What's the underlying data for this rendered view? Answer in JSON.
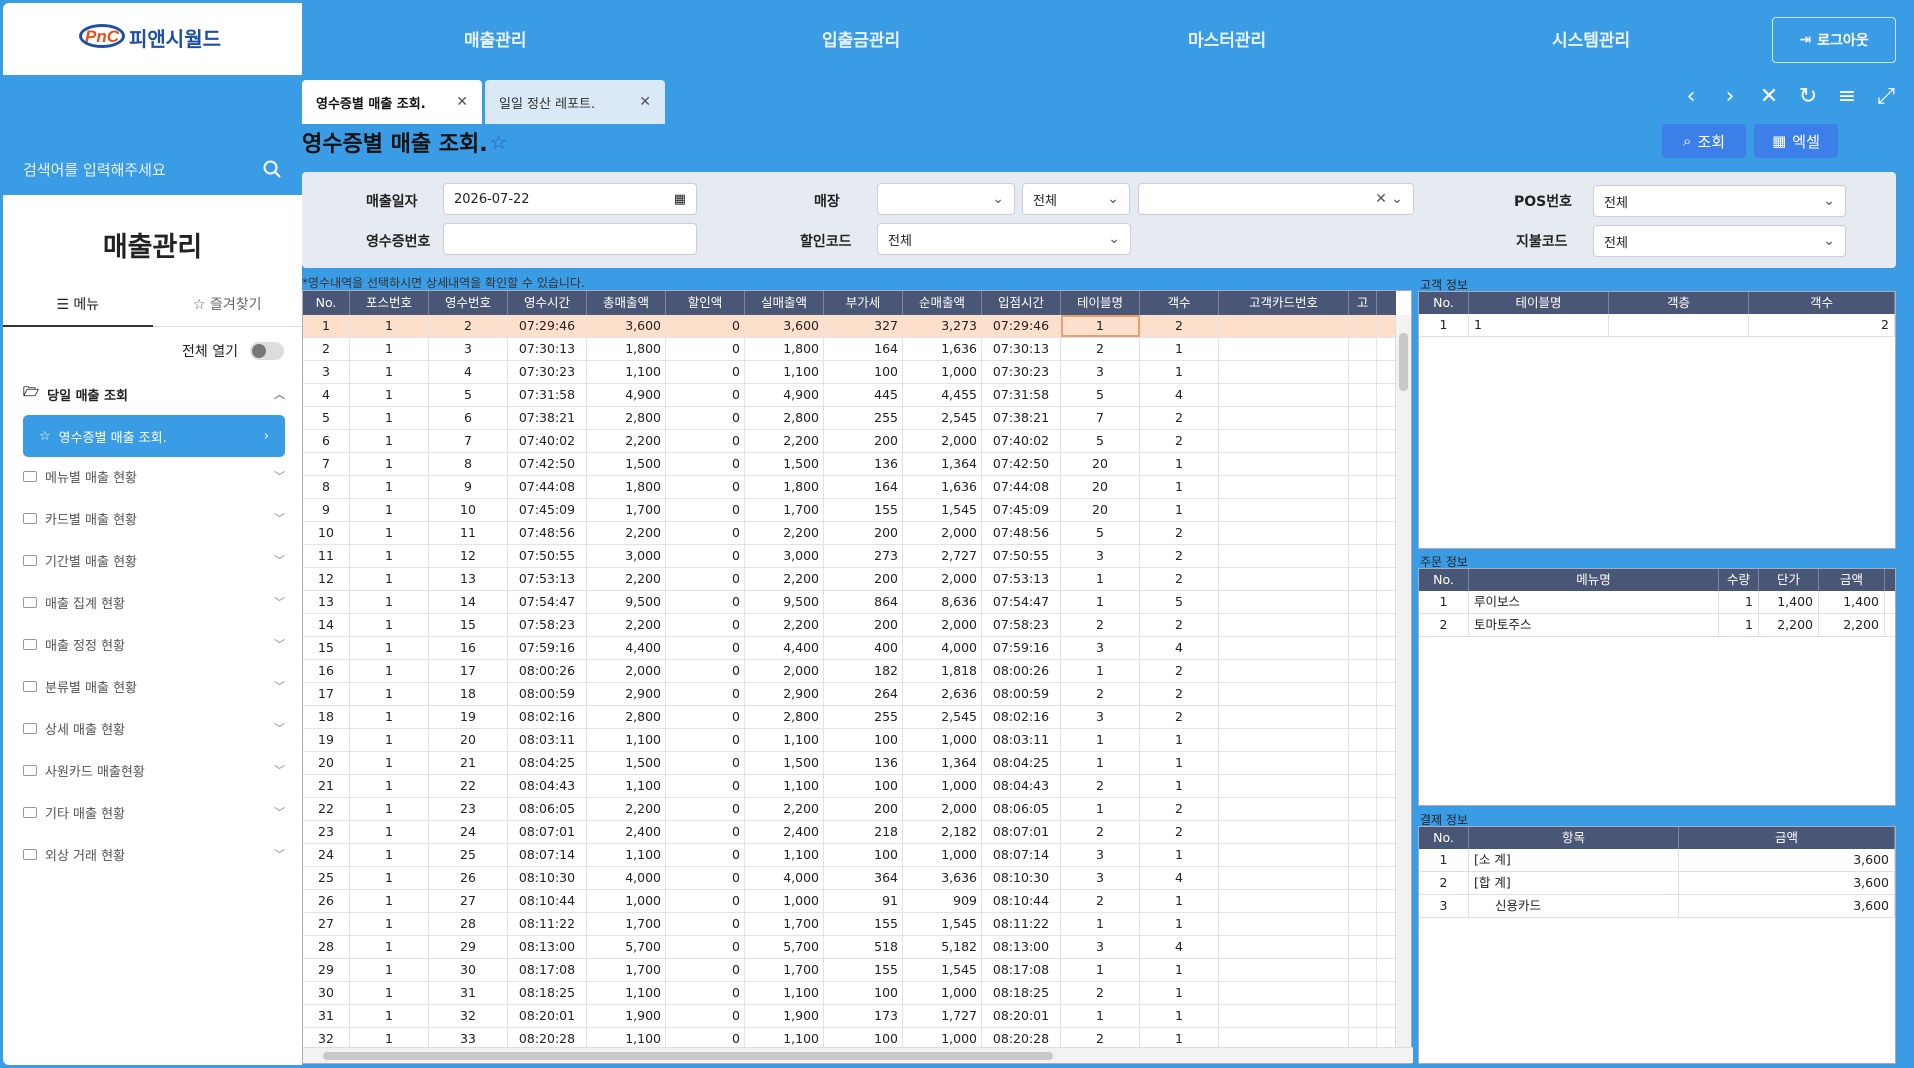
{
  "logo": {
    "brand": "PnC",
    "company": "피앤시월드"
  },
  "sidebar": {
    "search_placeholder": "검색어를 입력해주세요",
    "title": "매출관리",
    "tab_menu": "메뉴",
    "tab_fav": "즐겨찾기",
    "expand_all": "전체 열기",
    "group_head": "당일 매출 조회",
    "active_item": "영수증별 매출 조회.",
    "items": [
      "메뉴별 매출 현황",
      "카드별 매출 현황",
      "기간별 매출 현황",
      "매출 집계 현황",
      "매출 정정 현황",
      "분류별 매출 현황",
      "상세 매출 현황",
      "사원카드 매출현황",
      "기타 매출 현황",
      "외상 거래 현황"
    ]
  },
  "topnav": {
    "items": [
      "매출관리",
      "입출금관리",
      "마스터관리",
      "시스템관리"
    ],
    "logout": "로그아웃"
  },
  "tabs": [
    {
      "label": "영수증별 매출 조회."
    },
    {
      "label": "일일 정산 레포트."
    }
  ],
  "page": {
    "title": "영수증별 매출 조회.",
    "btn_search": "조회",
    "btn_excel": "엑셀"
  },
  "filters": {
    "date_label": "매출일자",
    "date_value": "2026-07-22",
    "store_label": "매장",
    "store_sel2": "전체",
    "pos_label": "POS번호",
    "pos_value": "전체",
    "receipt_label": "영수증번호",
    "discount_label": "할인코드",
    "discount_value": "전체",
    "pay_label": "지불코드",
    "pay_value": "전체"
  },
  "hint": "*영수내역을 선택하시면 상세내역을 확인할 수 있습니다.",
  "grid": {
    "headers": [
      "No.",
      "포스번호",
      "영수번호",
      "영수시간",
      "총매출액",
      "할인액",
      "실매출액",
      "부가세",
      "순매출액",
      "입점시간",
      "테이블명",
      "객수",
      "고객카드번호",
      "고"
    ],
    "rows": [
      [
        "1",
        "1",
        "2",
        "07:29:46",
        "3,600",
        "0",
        "3,600",
        "327",
        "3,273",
        "07:29:46",
        "1",
        "2"
      ],
      [
        "2",
        "1",
        "3",
        "07:30:13",
        "1,800",
        "0",
        "1,800",
        "164",
        "1,636",
        "07:30:13",
        "2",
        "1"
      ],
      [
        "3",
        "1",
        "4",
        "07:30:23",
        "1,100",
        "0",
        "1,100",
        "100",
        "1,000",
        "07:30:23",
        "3",
        "1"
      ],
      [
        "4",
        "1",
        "5",
        "07:31:58",
        "4,900",
        "0",
        "4,900",
        "445",
        "4,455",
        "07:31:58",
        "5",
        "4"
      ],
      [
        "5",
        "1",
        "6",
        "07:38:21",
        "2,800",
        "0",
        "2,800",
        "255",
        "2,545",
        "07:38:21",
        "7",
        "2"
      ],
      [
        "6",
        "1",
        "7",
        "07:40:02",
        "2,200",
        "0",
        "2,200",
        "200",
        "2,000",
        "07:40:02",
        "5",
        "2"
      ],
      [
        "7",
        "1",
        "8",
        "07:42:50",
        "1,500",
        "0",
        "1,500",
        "136",
        "1,364",
        "07:42:50",
        "20",
        "1"
      ],
      [
        "8",
        "1",
        "9",
        "07:44:08",
        "1,800",
        "0",
        "1,800",
        "164",
        "1,636",
        "07:44:08",
        "20",
        "1"
      ],
      [
        "9",
        "1",
        "10",
        "07:45:09",
        "1,700",
        "0",
        "1,700",
        "155",
        "1,545",
        "07:45:09",
        "20",
        "1"
      ],
      [
        "10",
        "1",
        "11",
        "07:48:56",
        "2,200",
        "0",
        "2,200",
        "200",
        "2,000",
        "07:48:56",
        "5",
        "2"
      ],
      [
        "11",
        "1",
        "12",
        "07:50:55",
        "3,000",
        "0",
        "3,000",
        "273",
        "2,727",
        "07:50:55",
        "3",
        "2"
      ],
      [
        "12",
        "1",
        "13",
        "07:53:13",
        "2,200",
        "0",
        "2,200",
        "200",
        "2,000",
        "07:53:13",
        "1",
        "2"
      ],
      [
        "13",
        "1",
        "14",
        "07:54:47",
        "9,500",
        "0",
        "9,500",
        "864",
        "8,636",
        "07:54:47",
        "1",
        "5"
      ],
      [
        "14",
        "1",
        "15",
        "07:58:23",
        "2,200",
        "0",
        "2,200",
        "200",
        "2,000",
        "07:58:23",
        "2",
        "2"
      ],
      [
        "15",
        "1",
        "16",
        "07:59:16",
        "4,400",
        "0",
        "4,400",
        "400",
        "4,000",
        "07:59:16",
        "3",
        "4"
      ],
      [
        "16",
        "1",
        "17",
        "08:00:26",
        "2,000",
        "0",
        "2,000",
        "182",
        "1,818",
        "08:00:26",
        "1",
        "2"
      ],
      [
        "17",
        "1",
        "18",
        "08:00:59",
        "2,900",
        "0",
        "2,900",
        "264",
        "2,636",
        "08:00:59",
        "2",
        "2"
      ],
      [
        "18",
        "1",
        "19",
        "08:02:16",
        "2,800",
        "0",
        "2,800",
        "255",
        "2,545",
        "08:02:16",
        "3",
        "2"
      ],
      [
        "19",
        "1",
        "20",
        "08:03:11",
        "1,100",
        "0",
        "1,100",
        "100",
        "1,000",
        "08:03:11",
        "1",
        "1"
      ],
      [
        "20",
        "1",
        "21",
        "08:04:25",
        "1,500",
        "0",
        "1,500",
        "136",
        "1,364",
        "08:04:25",
        "1",
        "1"
      ],
      [
        "21",
        "1",
        "22",
        "08:04:43",
        "1,100",
        "0",
        "1,100",
        "100",
        "1,000",
        "08:04:43",
        "2",
        "1"
      ],
      [
        "22",
        "1",
        "23",
        "08:06:05",
        "2,200",
        "0",
        "2,200",
        "200",
        "2,000",
        "08:06:05",
        "1",
        "2"
      ],
      [
        "23",
        "1",
        "24",
        "08:07:01",
        "2,400",
        "0",
        "2,400",
        "218",
        "2,182",
        "08:07:01",
        "2",
        "2"
      ],
      [
        "24",
        "1",
        "25",
        "08:07:14",
        "1,100",
        "0",
        "1,100",
        "100",
        "1,000",
        "08:07:14",
        "3",
        "1"
      ],
      [
        "25",
        "1",
        "26",
        "08:10:30",
        "4,000",
        "0",
        "4,000",
        "364",
        "3,636",
        "08:10:30",
        "3",
        "4"
      ],
      [
        "26",
        "1",
        "27",
        "08:10:44",
        "1,000",
        "0",
        "1,000",
        "91",
        "909",
        "08:10:44",
        "2",
        "1"
      ],
      [
        "27",
        "1",
        "28",
        "08:11:22",
        "1,700",
        "0",
        "1,700",
        "155",
        "1,545",
        "08:11:22",
        "1",
        "1"
      ],
      [
        "28",
        "1",
        "29",
        "08:13:00",
        "5,700",
        "0",
        "5,700",
        "518",
        "5,182",
        "08:13:00",
        "3",
        "4"
      ],
      [
        "29",
        "1",
        "30",
        "08:17:08",
        "1,700",
        "0",
        "1,700",
        "155",
        "1,545",
        "08:17:08",
        "1",
        "1"
      ],
      [
        "30",
        "1",
        "31",
        "08:18:25",
        "1,100",
        "0",
        "1,100",
        "100",
        "1,000",
        "08:18:25",
        "2",
        "1"
      ],
      [
        "31",
        "1",
        "32",
        "08:20:01",
        "1,900",
        "0",
        "1,900",
        "173",
        "1,727",
        "08:20:01",
        "1",
        "1"
      ],
      [
        "32",
        "1",
        "33",
        "08:20:28",
        "1,100",
        "0",
        "1,100",
        "100",
        "1,000",
        "08:20:28",
        "2",
        "1"
      ]
    ]
  },
  "customer": {
    "title": "고객 정보",
    "headers": [
      "No.",
      "테이블명",
      "객층",
      "객수"
    ],
    "rows": [
      [
        "1",
        "1",
        "",
        "2"
      ]
    ]
  },
  "order": {
    "title": "주문 정보",
    "headers": [
      "No.",
      "메뉴명",
      "수량",
      "단가",
      "금액"
    ],
    "rows": [
      [
        "1",
        "루이보스",
        "1",
        "1,400",
        "1,400"
      ],
      [
        "2",
        "토마토주스",
        "1",
        "2,200",
        "2,200"
      ]
    ]
  },
  "payment": {
    "title": "결제 정보",
    "headers": [
      "No.",
      "항목",
      "금액"
    ],
    "rows": [
      [
        "1",
        "[소 계]",
        "3,600"
      ],
      [
        "2",
        "[합 계]",
        "3,600"
      ],
      [
        "3",
        "   신용카드",
        "3,600"
      ]
    ]
  },
  "colors": {
    "accent": "#3b9ce6",
    "header_bg": "#4a5675",
    "selected_row": "#fde0cc",
    "button": "#3d7fe8"
  }
}
